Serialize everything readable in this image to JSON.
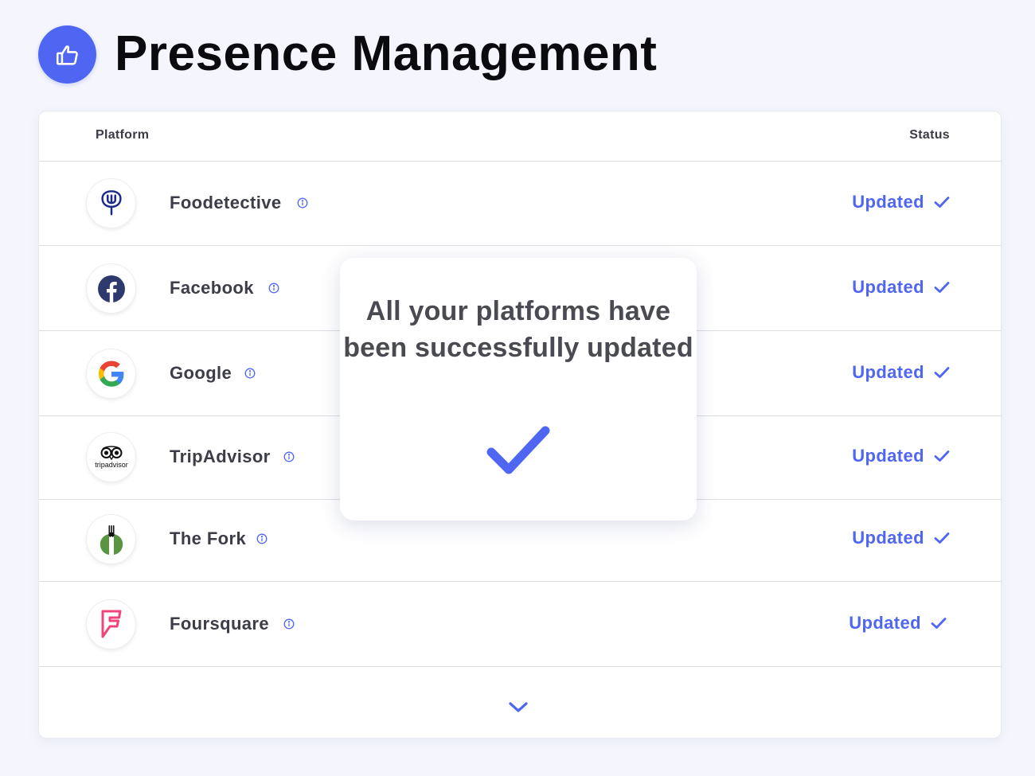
{
  "header": {
    "title": "Presence Management",
    "icon": "thumbs-up-icon",
    "icon_bg_color": "#4f66f2"
  },
  "table": {
    "columns": {
      "platform": "Platform",
      "status": "Status"
    },
    "rows": [
      {
        "name": "Foodetective",
        "icon": "foodetective-logo-icon",
        "status": "Updated"
      },
      {
        "name": "Facebook",
        "icon": "facebook-logo-icon",
        "status": "Updated"
      },
      {
        "name": "Google",
        "icon": "google-logo-icon",
        "status": "Updated"
      },
      {
        "name": "TripAdvisor",
        "icon": "tripadvisor-logo-icon",
        "status": "Updated"
      },
      {
        "name": "The Fork",
        "icon": "thefork-logo-icon",
        "status": "Updated"
      },
      {
        "name": "Foursquare",
        "icon": "foursquare-logo-icon",
        "status": "Updated"
      }
    ],
    "expand_icon": "chevron-down-icon"
  },
  "tripadvisor_wordmark": "tripadvisor",
  "modal": {
    "message": "All your platforms have been successfully updated",
    "icon": "check-icon"
  },
  "colors": {
    "accent": "#4f66f2",
    "status_text": "#4f66f2",
    "title_text": "#0b0b0f",
    "row_text": "#3c3d48",
    "page_background": "#f5f6fd"
  }
}
